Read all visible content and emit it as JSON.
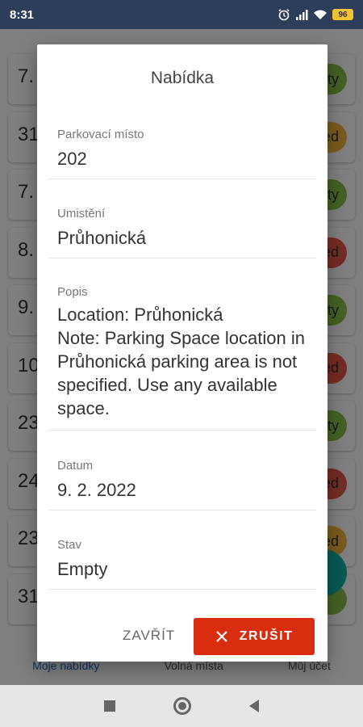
{
  "status_bar": {
    "time": "8:31",
    "battery": "96"
  },
  "background": {
    "rows": [
      {
        "num": "7.",
        "badge": "pty",
        "color": "#8bc34a"
      },
      {
        "num": "31",
        "badge": "ed",
        "color": "#f4b63f"
      },
      {
        "num": "7.",
        "badge": "pty",
        "color": "#8bc34a"
      },
      {
        "num": "8.",
        "badge": "ed",
        "color": "#e8584a"
      },
      {
        "num": "9.",
        "badge": "pty",
        "color": "#8bc34a"
      },
      {
        "num": "10",
        "badge": "ed",
        "color": "#e8584a"
      },
      {
        "num": "23",
        "badge": "pty",
        "color": "#8bc34a"
      },
      {
        "num": "24",
        "badge": "ed",
        "color": "#e8584a"
      },
      {
        "num": "23",
        "badge": "ed",
        "color": "#f4b63f"
      },
      {
        "num": "31",
        "badge": "",
        "color": "#8bc34a"
      }
    ],
    "nav": {
      "my_offers": "Moje nabídky",
      "free_spots": "Volná místa",
      "my_account": "Můj účet"
    }
  },
  "dialog": {
    "title": "Nabídka",
    "fields": [
      {
        "label": "Parkovací místo",
        "value": "202"
      },
      {
        "label": "Umistění",
        "value": "Průhonická"
      },
      {
        "label": "Popis",
        "value": "Location: Průhonická\nNote: Parking Space location in Průhonická parking area is not specified. Use any available space."
      },
      {
        "label": "Datum",
        "value": "9. 2. 2022"
      },
      {
        "label": "Stav",
        "value": "Empty"
      }
    ],
    "actions": {
      "close_label": "ZAVŘÍT",
      "cancel_label": "ZRUŠIT"
    }
  },
  "colors": {
    "accent": "#d92d10",
    "status_bar": "#2c3e59"
  }
}
